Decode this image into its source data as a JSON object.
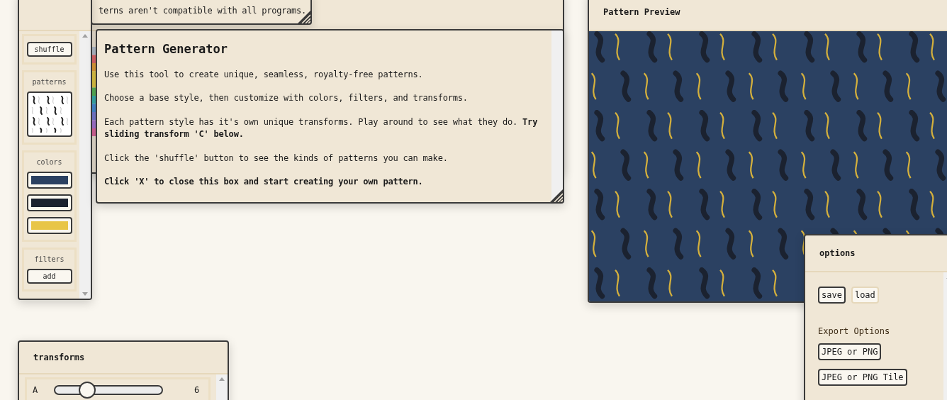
{
  "note_window": {
    "text": "terns aren't compatible with all programs."
  },
  "tools_panel": {
    "shuffle_button": "shuffle",
    "patterns_label": "patterns",
    "colors_label": "colors",
    "colors": [
      {
        "color": "#2b4162"
      },
      {
        "color": "#1b2230"
      },
      {
        "color": "#e8c547"
      }
    ],
    "filters_label": "filters",
    "add_button": "add"
  },
  "generator_window": {
    "title": "Pattern Generator",
    "paragraphs": [
      "Use this tool to create unique, seamless, royalty-free patterns.",
      "Choose a base style, then customize with colors, filters, and transforms.",
      "Each pattern style has it's own unique transforms. Play around to see what they do. **Try sliding transform 'C' below.**",
      "Click the 'shuffle' button to see the kinds of patterns you can make.",
      "**Click 'X' to close this box and start creating your own pattern.**"
    ]
  },
  "preview_window": {
    "title": "Pattern Preview"
  },
  "options_window": {
    "title": "options",
    "buttons": [
      {
        "label": "save",
        "selected": true
      },
      {
        "label": "load",
        "selected": false
      }
    ],
    "export_label": "Export Options",
    "export_buttons": [
      "JPEG or PNG",
      "JPEG or PNG Tile"
    ]
  },
  "transforms_window": {
    "title": "transforms",
    "sliders": [
      {
        "name": "A",
        "level": 0.3,
        "reading": "6"
      }
    ]
  }
}
